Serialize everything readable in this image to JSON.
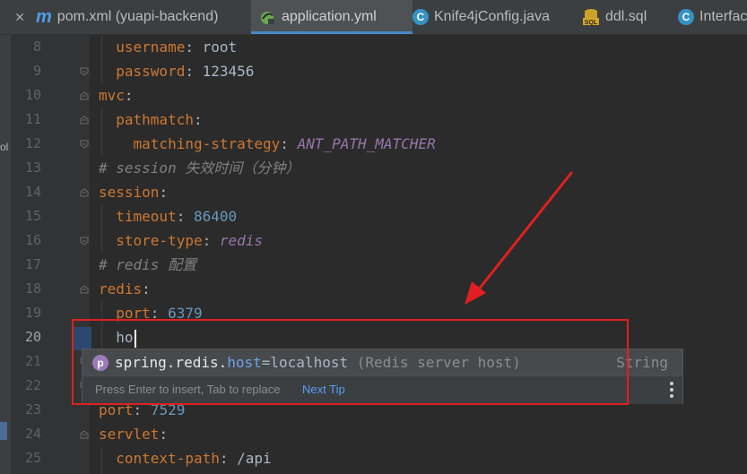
{
  "tabs": [
    {
      "icon": "maven-icon",
      "icon_glyph": "m",
      "label": "pom.xml (yuapi-backend)",
      "active": false,
      "closable": true
    },
    {
      "icon": "yaml-file-icon",
      "icon_glyph": "",
      "label": "application.yml",
      "active": true
    },
    {
      "icon": "java-class-icon",
      "icon_glyph": "C",
      "label": "Knife4jConfig.java",
      "active": false
    },
    {
      "icon": "sql-file-icon",
      "icon_glyph": "SQL",
      "label": "ddl.sql",
      "active": false
    },
    {
      "icon": "java-class-icon",
      "icon_glyph": "C",
      "label": "Interfac",
      "active": false
    }
  ],
  "left_strip_text": "ol",
  "line_numbers": [
    "8",
    "9",
    "10",
    "11",
    "12",
    "13",
    "14",
    "15",
    "16",
    "17",
    "18",
    "19",
    "20",
    "21",
    "22",
    "23",
    "24",
    "25"
  ],
  "current_line": "20",
  "code": {
    "l8": {
      "key": "username",
      "colon": ":",
      "value": "root"
    },
    "l9": {
      "key": "password",
      "colon": ":",
      "value": "123456"
    },
    "l10": {
      "key": "mvc",
      "colon": ":"
    },
    "l11": {
      "key": "pathmatch",
      "colon": ":"
    },
    "l12": {
      "key": "matching-strategy",
      "colon": ":",
      "value": "ANT_PATH_MATCHER"
    },
    "l13": {
      "comment": "# session 失效时间（分钟）"
    },
    "l14": {
      "key": "session",
      "colon": ":"
    },
    "l15": {
      "key": "timeout",
      "colon": ":",
      "value": "86400"
    },
    "l16": {
      "key": "store-type",
      "colon": ":",
      "value": "redis"
    },
    "l17": {
      "comment": "# redis 配置"
    },
    "l18": {
      "key": "redis",
      "colon": ":"
    },
    "l19": {
      "key": "port",
      "colon": ":",
      "value": "6379"
    },
    "l20": {
      "typed": "ho"
    },
    "l23": {
      "key": "port",
      "colon": ":",
      "value": "7529"
    },
    "l24": {
      "key": "servlet",
      "colon": ":"
    },
    "l25": {
      "key": "context-path",
      "colon": ":",
      "value": "/api"
    }
  },
  "completion": {
    "icon_glyph": "p",
    "prefix": "spring.redis.",
    "match": "host",
    "rest": "=localhost",
    "description": " (Redis server host)",
    "type": "String",
    "hint": "Press Enter to insert, Tab to replace",
    "next_tip": "Next Tip"
  },
  "colors": {
    "annotation": "#e02020",
    "keyword": "#cc7832",
    "number": "#6897bb",
    "enum": "#9876aa",
    "comment": "#808080"
  }
}
